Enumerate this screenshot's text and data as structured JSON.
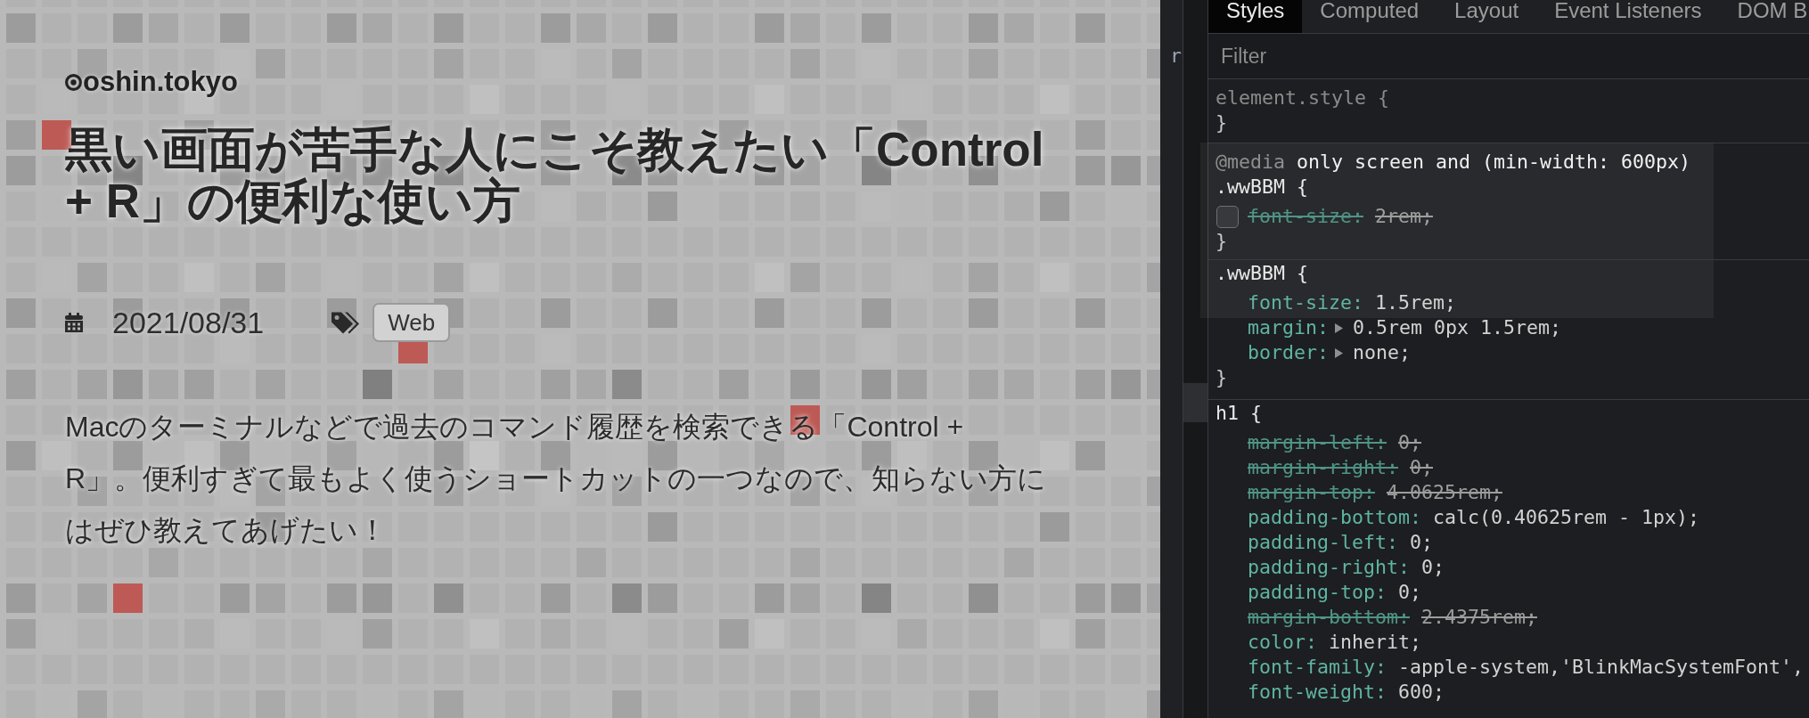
{
  "page": {
    "logo": {
      "text": "oshin.tokyo"
    },
    "title_lines": [
      "黒い画面が苦手な人にこそ教えたい「Control",
      "+ R」の便利な使い方"
    ],
    "date": "2021/08/31",
    "tags": [
      {
        "label": "Web"
      }
    ],
    "intro_lines": [
      "Macのターミナルなどで過去のコマンド履歴を検索できる「Control +",
      "R」。便利すぎて最もよく使うショートカットの一つなので、知らない方に",
      "はぜひ教えてあげたい！"
    ]
  },
  "devtools": {
    "elements_fragment": "r",
    "tabs": [
      {
        "label": "Styles",
        "selected": true
      },
      {
        "label": "Computed",
        "selected": false
      },
      {
        "label": "Layout",
        "selected": false
      },
      {
        "label": "Event Listeners",
        "selected": false
      },
      {
        "label": "DOM B",
        "selected": false
      }
    ],
    "filter": {
      "placeholder": "Filter"
    },
    "rules": [
      {
        "kind": "plain",
        "selector": "element.style {",
        "dimmed": true,
        "closing": "}"
      },
      {
        "kind": "media",
        "at_rule": "@media",
        "query": "only screen and (min-width: 600px)",
        "selector": ".wwBBM {",
        "dimmed": false,
        "declarations": [
          {
            "property": "font-size:",
            "value": "2rem;",
            "overridden": true,
            "expandable": false,
            "checkbox": {
              "checked": false
            }
          }
        ],
        "closing": "}"
      },
      {
        "kind": "plain",
        "selector": ".wwBBM {",
        "dimmed": false,
        "declarations": [
          {
            "property": "font-size:",
            "value": "1.5rem;",
            "overridden": false,
            "expandable": false
          },
          {
            "property": "margin:",
            "value": "0.5rem 0px 1.5rem;",
            "overridden": false,
            "expandable": true
          },
          {
            "property": "border:",
            "value": "none;",
            "overridden": false,
            "expandable": true
          }
        ],
        "closing": "}"
      },
      {
        "kind": "plain",
        "selector": "h1 {",
        "dimmed": false,
        "declarations": [
          {
            "property": "margin-left:",
            "value": "0;",
            "overridden": true,
            "expandable": false
          },
          {
            "property": "margin-right:",
            "value": "0;",
            "overridden": true,
            "expandable": false
          },
          {
            "property": "margin-top:",
            "value": "4.0625rem;",
            "overridden": true,
            "expandable": false
          },
          {
            "property": "padding-bottom:",
            "value": "calc(0.40625rem - 1px);",
            "overridden": false,
            "expandable": false
          },
          {
            "property": "padding-left:",
            "value": "0;",
            "overridden": false,
            "expandable": false
          },
          {
            "property": "padding-right:",
            "value": "0;",
            "overridden": false,
            "expandable": false
          },
          {
            "property": "padding-top:",
            "value": "0;",
            "overridden": false,
            "expandable": false
          },
          {
            "property": "margin-bottom:",
            "value": "2.4375rem;",
            "overridden": true,
            "expandable": false
          },
          {
            "property": "color:",
            "value": "inherit;",
            "overridden": false,
            "expandable": false
          },
          {
            "property": "font-family:",
            "value": "-apple-system,'BlinkMacSystemFont',",
            "overridden": false,
            "expandable": false
          },
          {
            "property": "font-weight:",
            "value": "600;",
            "overridden": false,
            "expandable": false
          }
        ]
      }
    ]
  }
}
